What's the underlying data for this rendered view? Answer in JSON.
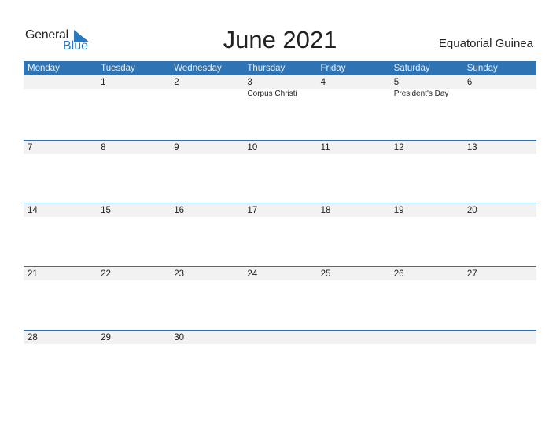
{
  "logo": {
    "part1": "General",
    "part2": "Blue"
  },
  "title": "June 2021",
  "country": "Equatorial Guinea",
  "colors": {
    "accent": "#2e74b5",
    "strip": "#f2f2f2"
  },
  "weekdays": [
    "Monday",
    "Tuesday",
    "Wednesday",
    "Thursday",
    "Friday",
    "Saturday",
    "Sunday"
  ],
  "weeks": [
    [
      {
        "d": ""
      },
      {
        "d": "1"
      },
      {
        "d": "2"
      },
      {
        "d": "3",
        "h": "Corpus Christi"
      },
      {
        "d": "4"
      },
      {
        "d": "5",
        "h": "President's Day"
      },
      {
        "d": "6"
      }
    ],
    [
      {
        "d": "7"
      },
      {
        "d": "8"
      },
      {
        "d": "9"
      },
      {
        "d": "10"
      },
      {
        "d": "11"
      },
      {
        "d": "12"
      },
      {
        "d": "13"
      }
    ],
    [
      {
        "d": "14"
      },
      {
        "d": "15"
      },
      {
        "d": "16"
      },
      {
        "d": "17"
      },
      {
        "d": "18"
      },
      {
        "d": "19"
      },
      {
        "d": "20"
      }
    ],
    [
      {
        "d": "21"
      },
      {
        "d": "22"
      },
      {
        "d": "23"
      },
      {
        "d": "24"
      },
      {
        "d": "25"
      },
      {
        "d": "26"
      },
      {
        "d": "27"
      }
    ],
    [
      {
        "d": "28"
      },
      {
        "d": "29"
      },
      {
        "d": "30"
      },
      {
        "d": ""
      },
      {
        "d": ""
      },
      {
        "d": ""
      },
      {
        "d": ""
      }
    ]
  ]
}
